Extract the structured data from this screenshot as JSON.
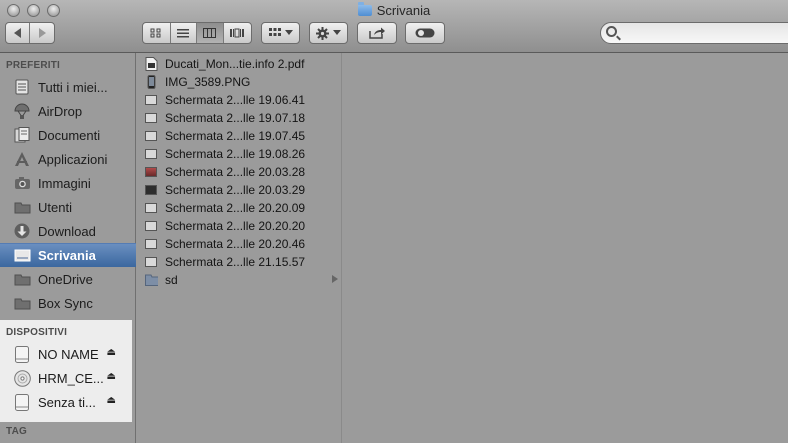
{
  "window": {
    "title": "Scrivania"
  },
  "toolbar": {
    "back_icon": "chevron-left-icon",
    "forward_icon": "chevron-right-icon",
    "view_modes": [
      "icon-view-icon",
      "list-view-icon",
      "column-view-icon",
      "coverflow-view-icon"
    ],
    "active_view": "column-view-icon",
    "arrange_icon": "arrange-grid-icon",
    "action_icon": "gear-icon",
    "share_icon": "share-icon",
    "tags_icon": "toggle-tags-icon",
    "search_placeholder": ""
  },
  "sidebar": {
    "favorites_heading": "PREFERITI",
    "favorites": [
      {
        "label": "Tutti i miei...",
        "icon": "all-files-icon"
      },
      {
        "label": "AirDrop",
        "icon": "airdrop-icon"
      },
      {
        "label": "Documenti",
        "icon": "documents-icon"
      },
      {
        "label": "Applicazioni",
        "icon": "applications-icon"
      },
      {
        "label": "Immagini",
        "icon": "camera-icon"
      },
      {
        "label": "Utenti",
        "icon": "folder-icon"
      },
      {
        "label": "Download",
        "icon": "download-icon"
      },
      {
        "label": "Scrivania",
        "icon": "desktop-icon",
        "selected": true
      },
      {
        "label": "OneDrive",
        "icon": "folder-icon"
      },
      {
        "label": "Box Sync",
        "icon": "folder-icon"
      }
    ],
    "devices_heading": "DISPOSITIVI",
    "devices": [
      {
        "label": "NO NAME",
        "icon": "disk-icon",
        "eject": true
      },
      {
        "label": "HRM_CE...",
        "icon": "cd-icon",
        "eject": true
      },
      {
        "label": "Senza ti...",
        "icon": "disk-icon",
        "eject": true
      }
    ],
    "tags_heading": "TAG",
    "eject_glyph": "⏏"
  },
  "files": [
    {
      "name": "Ducati_Mon...tie.info 2.pdf",
      "kind": "pdf"
    },
    {
      "name": "IMG_3589.PNG",
      "kind": "phone"
    },
    {
      "name": "Schermata 2...lle 19.06.41",
      "kind": "light"
    },
    {
      "name": "Schermata 2...lle 19.07.18",
      "kind": "light"
    },
    {
      "name": "Schermata 2...lle 19.07.45",
      "kind": "light"
    },
    {
      "name": "Schermata 2...lle 19.08.26",
      "kind": "light"
    },
    {
      "name": "Schermata 2...lle 20.03.28",
      "kind": "red"
    },
    {
      "name": "Schermata 2...lle 20.03.29",
      "kind": "dark"
    },
    {
      "name": "Schermata 2...lle 20.20.09",
      "kind": "light"
    },
    {
      "name": "Schermata 2...lle 20.20.20",
      "kind": "light"
    },
    {
      "name": "Schermata 2...lle 20.20.46",
      "kind": "light"
    },
    {
      "name": "Schermata 2...lle 21.15.57",
      "kind": "light"
    },
    {
      "name": "sd",
      "kind": "folder",
      "has_children": true
    }
  ]
}
